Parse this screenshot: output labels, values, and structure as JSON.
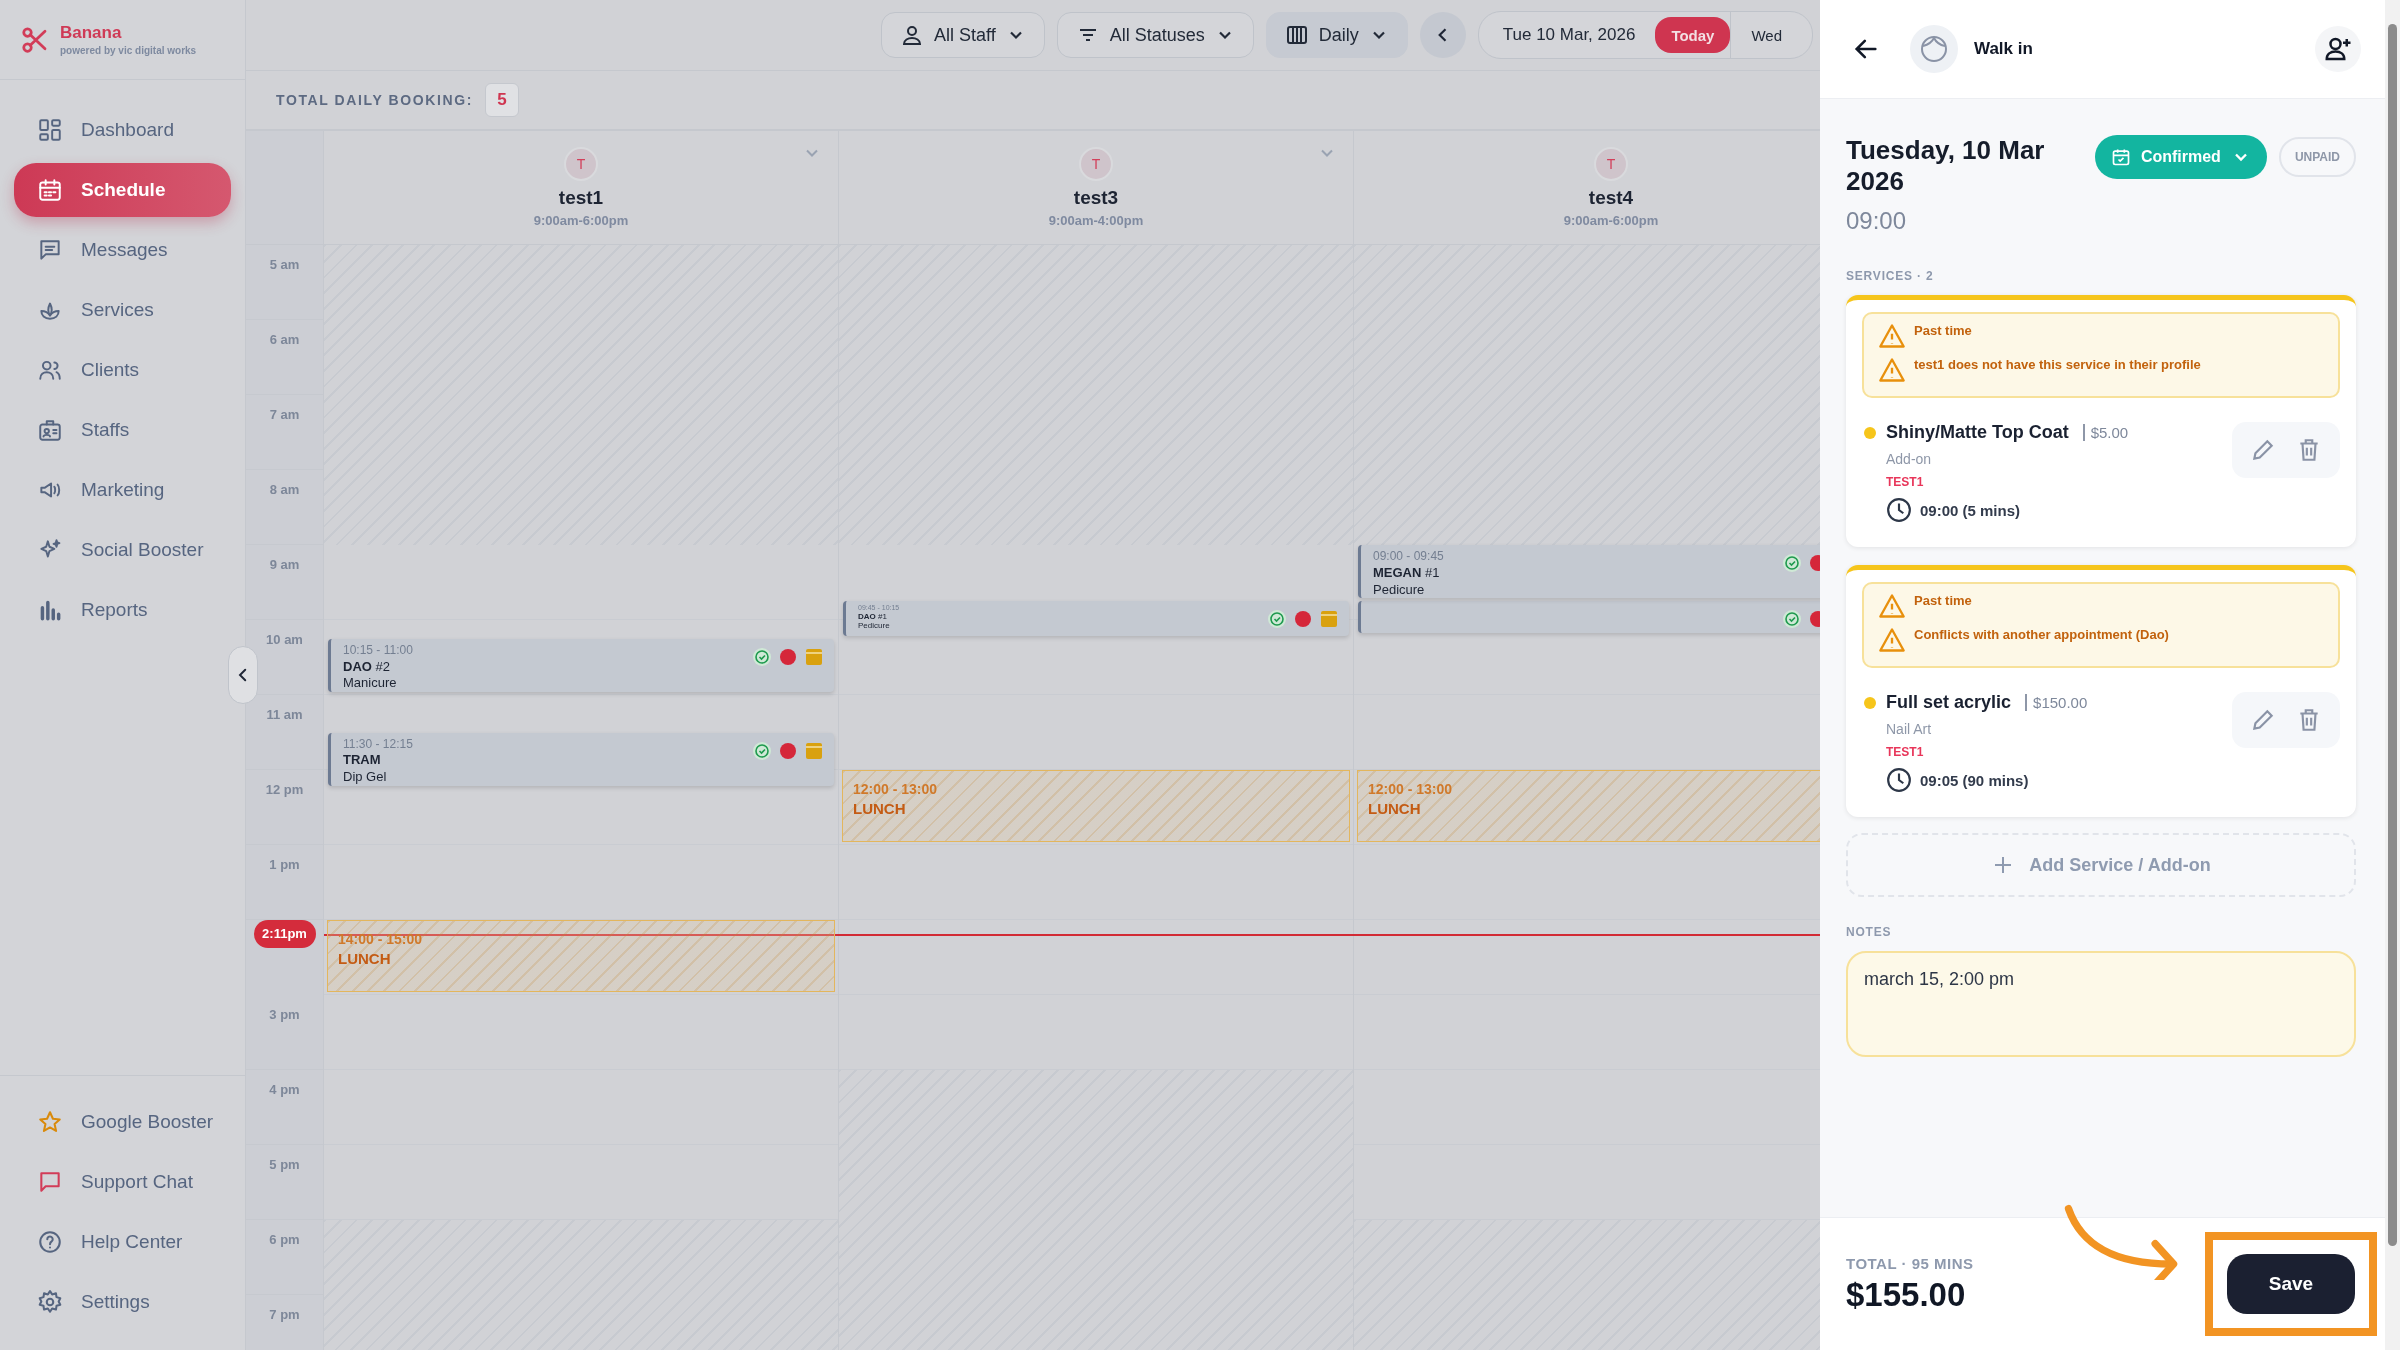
{
  "brand": {
    "name": "Banana",
    "tagline": "powered by vic digital works"
  },
  "nav": [
    {
      "label": "Dashboard",
      "selected": false
    },
    {
      "label": "Schedule",
      "selected": true
    },
    {
      "label": "Messages",
      "selected": false
    },
    {
      "label": "Services",
      "selected": false
    },
    {
      "label": "Clients",
      "selected": false
    },
    {
      "label": "Staffs",
      "selected": false
    },
    {
      "label": "Marketing",
      "selected": false
    },
    {
      "label": "Social Booster",
      "selected": false
    },
    {
      "label": "Reports",
      "selected": false
    }
  ],
  "nav_bottom": [
    {
      "label": "Google Booster"
    },
    {
      "label": "Support Chat"
    },
    {
      "label": "Help Center"
    },
    {
      "label": "Settings"
    }
  ],
  "toolbar": {
    "staff_filter": "All Staff",
    "status_filter": "All Statuses",
    "view": "Daily",
    "date": "Tue 10 Mar, 2026",
    "today": "Today",
    "next_day": "Wed"
  },
  "booking_total": {
    "label": "TOTAL DAILY BOOKING:",
    "count": "5"
  },
  "hours": [
    "5 am",
    "6 am",
    "7 am",
    "8 am",
    "9 am",
    "10 am",
    "11 am",
    "12 pm",
    "1 pm"
  ],
  "now": "2:11pm",
  "hours_after": [
    "3 pm",
    "4 pm",
    "5 pm",
    "6 pm",
    "7 pm"
  ],
  "staff": [
    {
      "initial": "T",
      "name": "test1",
      "hours": "9:00am-6:00pm",
      "events": [
        {
          "kind": "booking",
          "time": "10:15 - 11:00",
          "name": "**DAO** #2",
          "service": "Manicure"
        },
        {
          "kind": "booking",
          "time": "11:30 - 12:15",
          "name": "**TRAM**",
          "service": "Dip Gel"
        }
      ],
      "breaks": [
        {
          "time": "14:00 - 15:00",
          "label": "LUNCH"
        }
      ]
    },
    {
      "initial": "T",
      "name": "test3",
      "hours": "9:00am-4:00pm",
      "events": [
        {
          "kind": "compact",
          "time": "09:45 - 10:15",
          "name": "**DAO** #1",
          "service": "Pedicure"
        }
      ],
      "breaks": [
        {
          "time": "12:00 - 13:00",
          "label": "LUNCH"
        }
      ]
    },
    {
      "initial": "T",
      "name": "test4",
      "hours": "9:00am-6:00pm",
      "events": [
        {
          "kind": "booking",
          "time": "09:00 - 09:45",
          "name": "**MEGAN** #1",
          "service": "Pedicure"
        },
        {
          "kind": "covered"
        }
      ],
      "breaks": [
        {
          "time": "12:00 - 13:00",
          "label": "LUNCH"
        }
      ]
    }
  ],
  "panel": {
    "client": "Walk in",
    "date": "Tuesday, 10 Mar 2026",
    "time": "09:00",
    "status": "Confirmed",
    "payment": "UNPAID",
    "services_label": "SERVICES · 2",
    "services": [
      {
        "warnings": [
          "Past time",
          "test1 does not have this service in their profile"
        ],
        "name": "Shiny/Matte Top Coat",
        "price": "$5.00",
        "category": "Add-on",
        "staff": "TEST1",
        "time": "09:00 (5 mins)"
      },
      {
        "warnings": [
          "Past time",
          "Conflicts with another appointment (Dao)"
        ],
        "name": "Full set acrylic",
        "price": "$150.00",
        "category": "Nail Art",
        "staff": "TEST1",
        "time": "09:05 (90 mins)"
      }
    ],
    "add_service": "Add Service / Add-on",
    "notes_label": "NOTES",
    "notes": "march 15, 2:00 pm",
    "total_label": "TOTAL · 95 MINS",
    "total": "$155.00",
    "save": "Save"
  }
}
